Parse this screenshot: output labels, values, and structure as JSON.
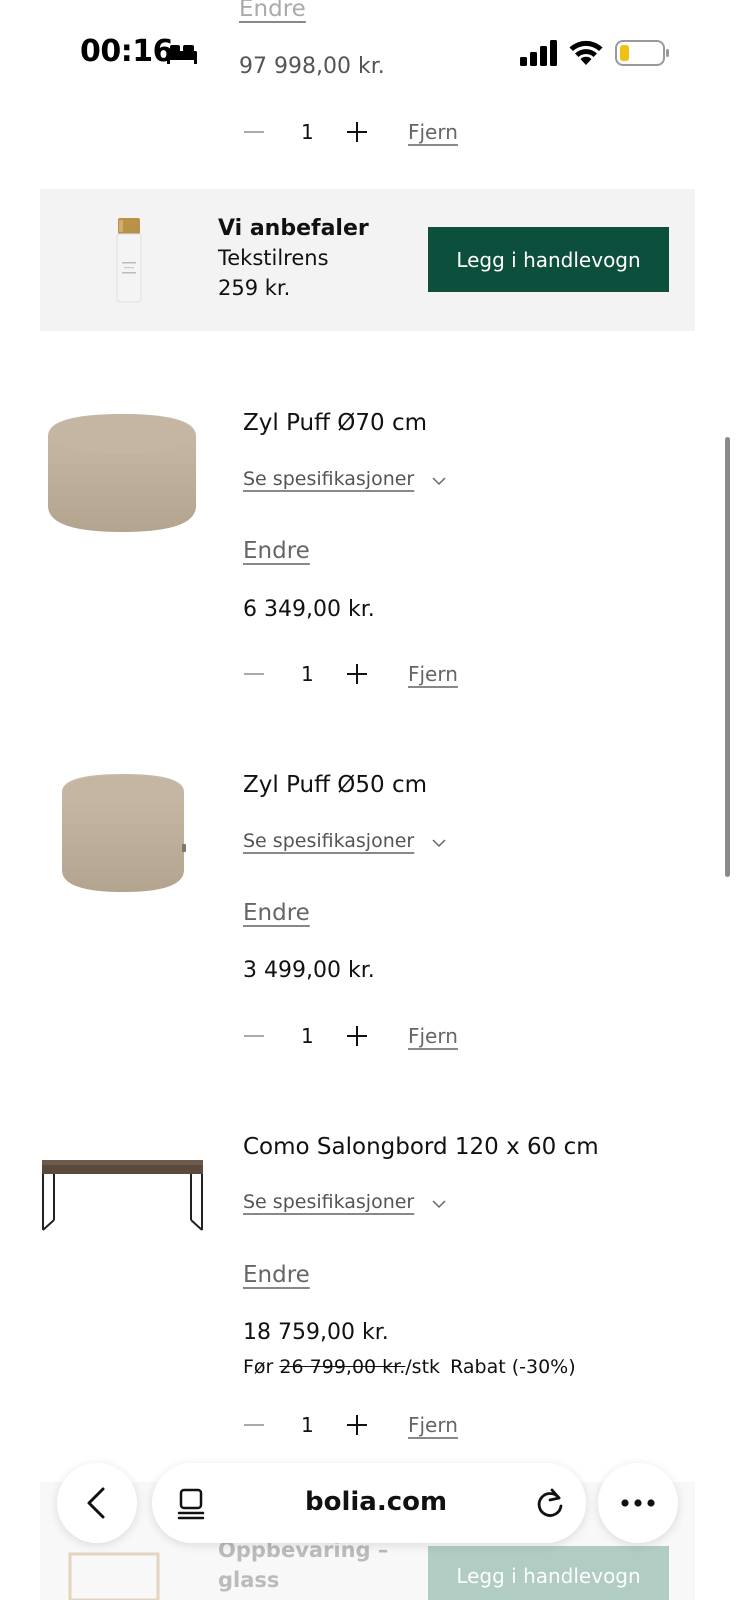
{
  "status_bar": {
    "time": "00:16",
    "icons": [
      "bed-icon",
      "cellular-signal-icon",
      "wifi-icon",
      "battery-icon"
    ],
    "battery_color": "#f2c014"
  },
  "top_item": {
    "endre_label": "Endre",
    "price": "97 998,00 kr.",
    "quantity": "1",
    "remove_label": "Fjern"
  },
  "recommendation": {
    "heading": "Vi anbefaler",
    "product": "Tekstilrens",
    "price": "259 kr.",
    "button_label": "Legg i handlevogn",
    "button_color": "#0d4f3d"
  },
  "cart_items": [
    {
      "name": "Zyl Puff Ø70 cm",
      "spec_label": "Se spesifikasjoner",
      "endre_label": "Endre",
      "price": "6 349,00 kr.",
      "quantity": "1",
      "remove_label": "Fjern",
      "image": "pouf-large-image"
    },
    {
      "name": "Zyl Puff Ø50 cm",
      "spec_label": "Se spesifikasjoner",
      "endre_label": "Endre",
      "price": "3 499,00 kr.",
      "quantity": "1",
      "remove_label": "Fjern",
      "image": "pouf-small-image"
    },
    {
      "name": "Como Salongbord 120 x 60 cm",
      "spec_label": "Se spesifikasjoner",
      "endre_label": "Endre",
      "price": "18 759,00 kr.",
      "before_label": "Før",
      "old_price": "26 799,00 kr.",
      "per_unit": "/stk",
      "discount": "Rabat (-30%)",
      "quantity": "1",
      "remove_label": "Fjern",
      "image": "coffee-table-image"
    }
  ],
  "recommendation_2": {
    "product_line1": "Oppbevaring –",
    "product_line2": "glass",
    "button_label": "Legg i handlevogn"
  },
  "browser": {
    "url": "bolia.com",
    "icons": [
      "back-icon",
      "tabs-icon",
      "reload-icon",
      "more-icon"
    ]
  }
}
